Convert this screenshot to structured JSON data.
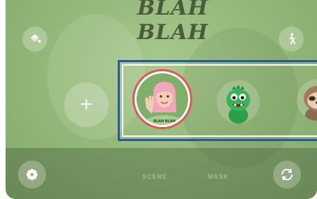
{
  "camera": {
    "add_label": "+",
    "hood_print": "BLAH BLAH",
    "modes": [
      "SCENE",
      "MASK"
    ],
    "emojis": [
      {
        "name": "My Emoji avatar",
        "selected": true
      },
      {
        "name": "Green dinosaur emoji",
        "selected": false
      },
      {
        "name": "Sloth emoji",
        "selected": false
      }
    ],
    "icons": {
      "top_left": "paint-bucket-icon",
      "top_right": "walking-figure-icon",
      "bottom_left": "flower-icon",
      "bottom_right": "switch-camera-icon"
    },
    "colors": {
      "highlight": "#1f5aa3",
      "selected_ring": "#e2574f"
    }
  }
}
